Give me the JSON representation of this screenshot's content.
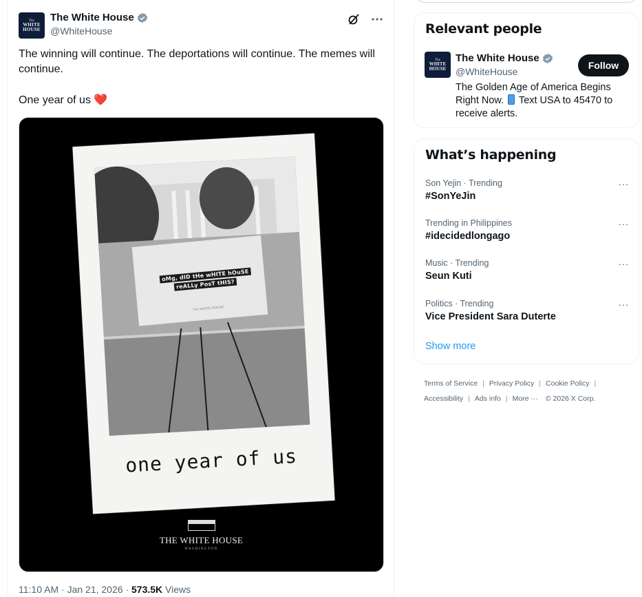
{
  "tweet": {
    "author_name": "The White House",
    "author_handle": "@WhiteHouse",
    "avatar_text_top": "The",
    "avatar_text_mid": "WHITE",
    "avatar_text_bot": "HOUSE",
    "text_line1": "The winning will continue. The deportations will continue. The memes will continue.",
    "text_line2": "One year of us ❤️",
    "image": {
      "sign_line1": "oMg, dID tHe wHITE hOuSE",
      "sign_line2": "reALLy PosT tHIS?",
      "sign_footer": "The WHITE HOUSE",
      "caption": "one year of us",
      "logo_title": "THE WHITE HOUSE",
      "logo_sub": "WASHINGTON"
    },
    "time": "11:10 AM",
    "date": "Jan 21, 2026",
    "views_count": "573.5K",
    "views_label": "Views",
    "sep": "·"
  },
  "relevant_people": {
    "heading": "Relevant people",
    "name": "The White House",
    "handle": "@WhiteHouse",
    "follow_label": "Follow",
    "bio_part1": "The Golden Age of America Begins Right Now.",
    "bio_part2": "Text USA to 45470 to receive alerts."
  },
  "trends": {
    "heading": "What’s happening",
    "items": [
      {
        "context": "Son Yejin · Trending",
        "title": "#SonYeJin"
      },
      {
        "context": "Trending in Philippines",
        "title": "#idecidedlongago"
      },
      {
        "context": "Music · Trending",
        "title": "Seun Kuti"
      },
      {
        "context": "Politics · Trending",
        "title": "Vice President Sara Duterte"
      }
    ],
    "more_dots": "···",
    "show_more": "Show more"
  },
  "footer": {
    "links": [
      "Terms of Service",
      "Privacy Policy",
      "Cookie Policy",
      "Accessibility",
      "Ads info",
      "More ···"
    ],
    "copyright": "© 2026 X Corp.",
    "divider": "|"
  },
  "colors": {
    "accent": "#1d9bf0",
    "text": "#0f1419",
    "muted": "#536471",
    "verified": "#829aab"
  },
  "icons": [
    "verified-badge-icon",
    "grok-icon",
    "more-icon",
    "heart-emoji",
    "phone-emoji-icon"
  ]
}
